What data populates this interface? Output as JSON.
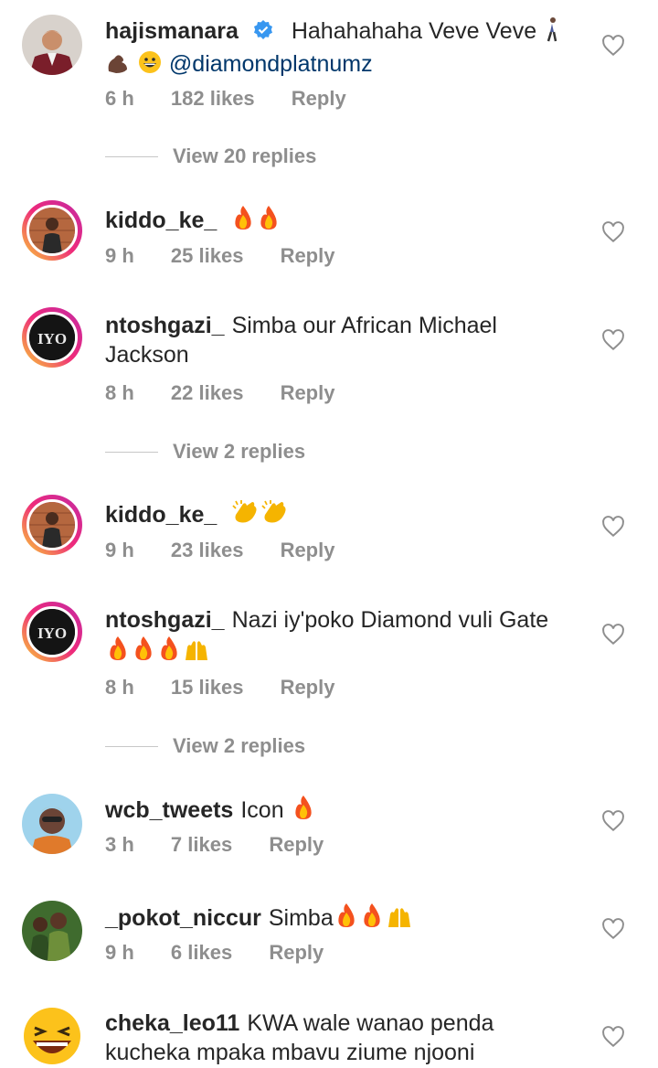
{
  "comments": [
    {
      "username": "hajismanara",
      "verified": true,
      "text": "Hahahahaha Veve Veve",
      "mention": "@diamondplatnumz",
      "time": "6 h",
      "likes": "182 likes",
      "reply": "Reply",
      "avatar": "avatar-man-suit"
    },
    {
      "username": "kiddo_ke_",
      "text": "",
      "time": "9 h",
      "likes": "25 likes",
      "reply": "Reply",
      "avatar": "avatar-boy-brick-wall"
    },
    {
      "username": "ntoshgazi_",
      "text": "Simba our African Michael Jackson",
      "time": "8 h",
      "likes": "22 likes",
      "reply": "Reply",
      "avatar": "avatar-iyo-album"
    },
    {
      "username": "kiddo_ke_",
      "text": "",
      "time": "9 h",
      "likes": "23 likes",
      "reply": "Reply",
      "avatar": "avatar-boy-brick-wall"
    },
    {
      "username": "ntoshgazi_",
      "text": "Nazi iy'poko Diamond vuli Gate",
      "time": "8 h",
      "likes": "15 likes",
      "reply": "Reply",
      "avatar": "avatar-iyo-album"
    },
    {
      "username": "wcb_tweets",
      "text": "Icon",
      "time": "3 h",
      "likes": "7 likes",
      "reply": "Reply",
      "avatar": "avatar-man-sunglasses"
    },
    {
      "username": "_pokot_niccur",
      "text": "Simba",
      "time": "9 h",
      "likes": "6 likes",
      "reply": "Reply",
      "avatar": "avatar-group-green"
    },
    {
      "username": "cheka_leo11",
      "text": "KWA wale wanao penda kucheka mpaka mbavu ziume njooni",
      "avatar": "avatar-laughing-emoji"
    }
  ],
  "view_replies": [
    "View 20 replies",
    "View 2 replies",
    "View 2 replies"
  ],
  "iyo_label": "IYO",
  "colors": {
    "text": "#262626",
    "secondary": "#8e8e8e",
    "mention": "#00376b",
    "verified": "#3897f0"
  }
}
